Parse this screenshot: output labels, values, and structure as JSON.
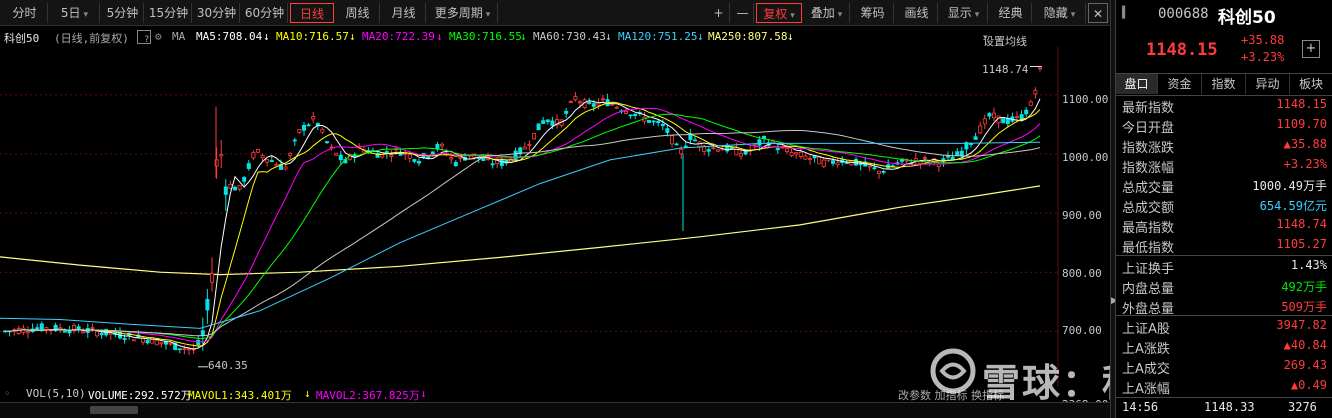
{
  "toolbar": {
    "tabs": [
      {
        "label": "分时",
        "caret": false
      },
      {
        "label": "5日",
        "caret": true
      },
      {
        "label": "5分钟",
        "caret": false
      },
      {
        "label": "15分钟",
        "caret": false
      },
      {
        "label": "30分钟",
        "caret": false
      },
      {
        "label": "60分钟",
        "caret": false
      },
      {
        "label": "日线",
        "caret": false
      },
      {
        "label": "周线",
        "caret": false
      },
      {
        "label": "月线",
        "caret": false
      },
      {
        "label": "更多周期",
        "caret": true
      }
    ],
    "plus": "+",
    "minus": "—",
    "right": [
      {
        "label": "复权",
        "caret": true
      },
      {
        "label": "叠加",
        "caret": true
      },
      {
        "label": "筹码"
      },
      {
        "label": "画线"
      },
      {
        "label": "显示",
        "caret": true
      },
      {
        "label": "经典"
      },
      {
        "label": "隐藏",
        "caret": true
      }
    ]
  },
  "legend": {
    "name": "科创50",
    "mode": "(日线,前复权)",
    "q": "?",
    "ma": "MA",
    "ma5": "MA5:708.04",
    "ma10": "MA10:716.57",
    "ma20": "MA20:722.39",
    "ma30": "MA30:716.55",
    "ma60": "MA60:730.43",
    "ma120": "MA120:751.25",
    "ma250": "MA250:807.58",
    "settings": "设置均线"
  },
  "colors": {
    "up": "#ff3b3b",
    "down": "#00e6e6",
    "ma5": "#ffffff",
    "ma10": "#ffff00",
    "ma20": "#ff00ff",
    "ma30": "#00ff00",
    "ma60": "#c8c8c8",
    "ma120": "#3ad0ff",
    "ma250": "#ffff80"
  },
  "chart_data": {
    "type": "candlestick",
    "y_ticks": [
      "1100.00",
      "1000.00",
      "900.00",
      "800.00",
      "700.00"
    ],
    "ylim": [
      616,
      1181
    ],
    "high_label": "1148.74",
    "low_label": "640.35",
    "volume_tick": "2368.00"
  },
  "volume": {
    "label": "VOL(5,10)",
    "volume": "VOLUME:292.572万",
    "mavol1": "MAVOL1:343.401万",
    "mavol2": "MAVOL2:367.825万",
    "right_links": "改参数  加指标  换指标"
  },
  "watermark": "雪球：科创板日报",
  "panel": {
    "code": "000688",
    "name": "科创50",
    "price": "1148.15",
    "change": "+35.88",
    "change_pct": "+3.23%",
    "plus": "+",
    "tabs": [
      "盘口",
      "资金",
      "指数",
      "异动",
      "板块"
    ],
    "rows1": [
      {
        "k": "最新指数",
        "v": "1148.15",
        "c": "red"
      },
      {
        "k": "今日开盘",
        "v": "1109.70",
        "c": "red"
      },
      {
        "k": "指数涨跌",
        "v": "▲35.88",
        "c": "red"
      },
      {
        "k": "指数涨幅",
        "v": "+3.23%",
        "c": "red"
      },
      {
        "k": "总成交量",
        "v": "1000.49万手",
        "c": "white"
      },
      {
        "k": "总成交额",
        "v": "654.59亿元",
        "c": "cyan"
      },
      {
        "k": "最高指数",
        "v": "1148.74",
        "c": "red"
      },
      {
        "k": "最低指数",
        "v": "1105.27",
        "c": "red"
      }
    ],
    "rows2": [
      {
        "k": "上证换手",
        "v": "1.43%",
        "c": "white"
      },
      {
        "k": "内盘总量",
        "v": "492万手",
        "c": "green"
      },
      {
        "k": "外盘总量",
        "v": "509万手",
        "c": "red"
      }
    ],
    "rows3": [
      {
        "k": "上证A股",
        "v": "3947.82",
        "c": "red"
      },
      {
        "k": "上A涨跌",
        "v": "▲40.84",
        "c": "red"
      },
      {
        "k": "上A成交",
        "v": "269.43",
        "c": "red"
      },
      {
        "k": "上A涨幅",
        "v": "▲0.49",
        "c": "red"
      }
    ],
    "footer_time": "14:56",
    "footer_price": "1148.33",
    "footer_vol": "3276"
  }
}
